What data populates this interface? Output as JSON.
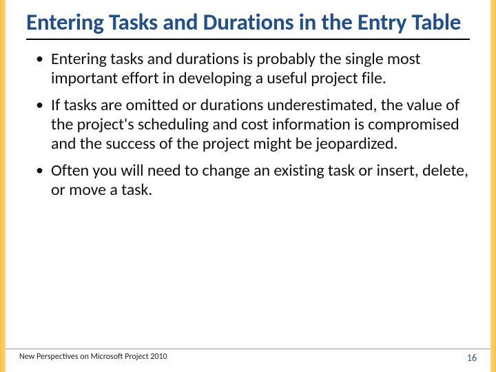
{
  "title": "Entering Tasks and Durations in the Entry Table",
  "bullets": [
    "Entering tasks and durations is probably the single most important effort in developing a useful project file.",
    "If tasks are omitted or durations underestimated, the value of the project's scheduling and cost information is compromised and the success of the project might be jeopardized.",
    "Often you will need to change an existing task or insert, delete, or move a task."
  ],
  "footer": {
    "source": "New Perspectives on Microsoft Project 2010",
    "page": "16"
  }
}
